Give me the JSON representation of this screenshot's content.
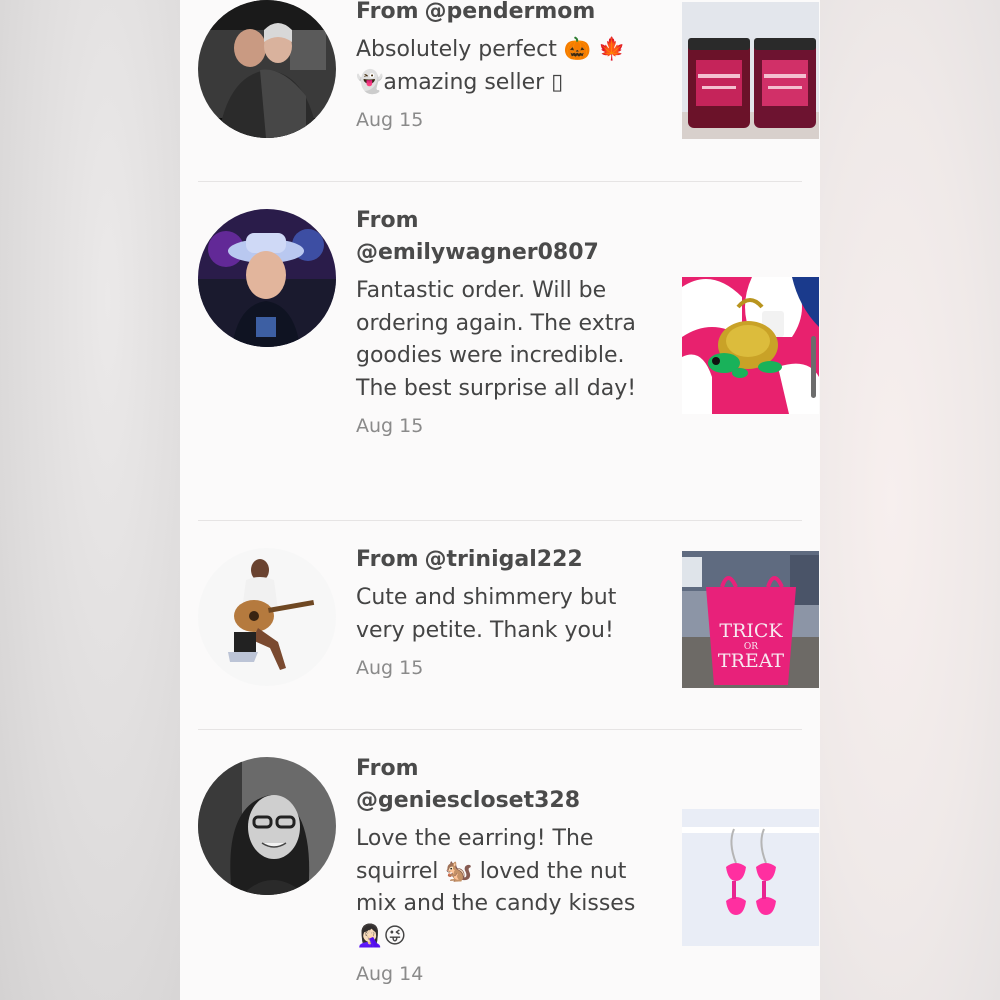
{
  "reviews": [
    {
      "from_label": "From",
      "username": "@pendermom",
      "comment": "Absolutely perfect 🎃 🍁 👻amazing seller ▯",
      "date": "Aug 15"
    },
    {
      "from_label": "From",
      "username": "@emilywagner0807",
      "comment": "Fantastic order. Will be ordering again. The extra goodies were incredible. The best surprise all day!",
      "date": "Aug 15"
    },
    {
      "from_label": "From",
      "username": "@trinigal222",
      "comment": "Cute and shimmery but very petite. Thank you!",
      "date": "Aug 15"
    },
    {
      "from_label": "From",
      "username": "@geniescloset328",
      "comment": "Love the earring! The squirrel 🐿️ loved the nut mix and the candy kisses 🤦🏻‍♀️😜",
      "date": "Aug 14"
    }
  ],
  "thumb_text": {
    "trick": "TRICK",
    "or": "OR",
    "treat": "TREAT"
  },
  "colors": {
    "panel_bg": "#fbfafa",
    "text": "#444444",
    "date": "#8a8a8a",
    "divider": "#e6e4e4",
    "accent_pink": "#e8216e"
  }
}
